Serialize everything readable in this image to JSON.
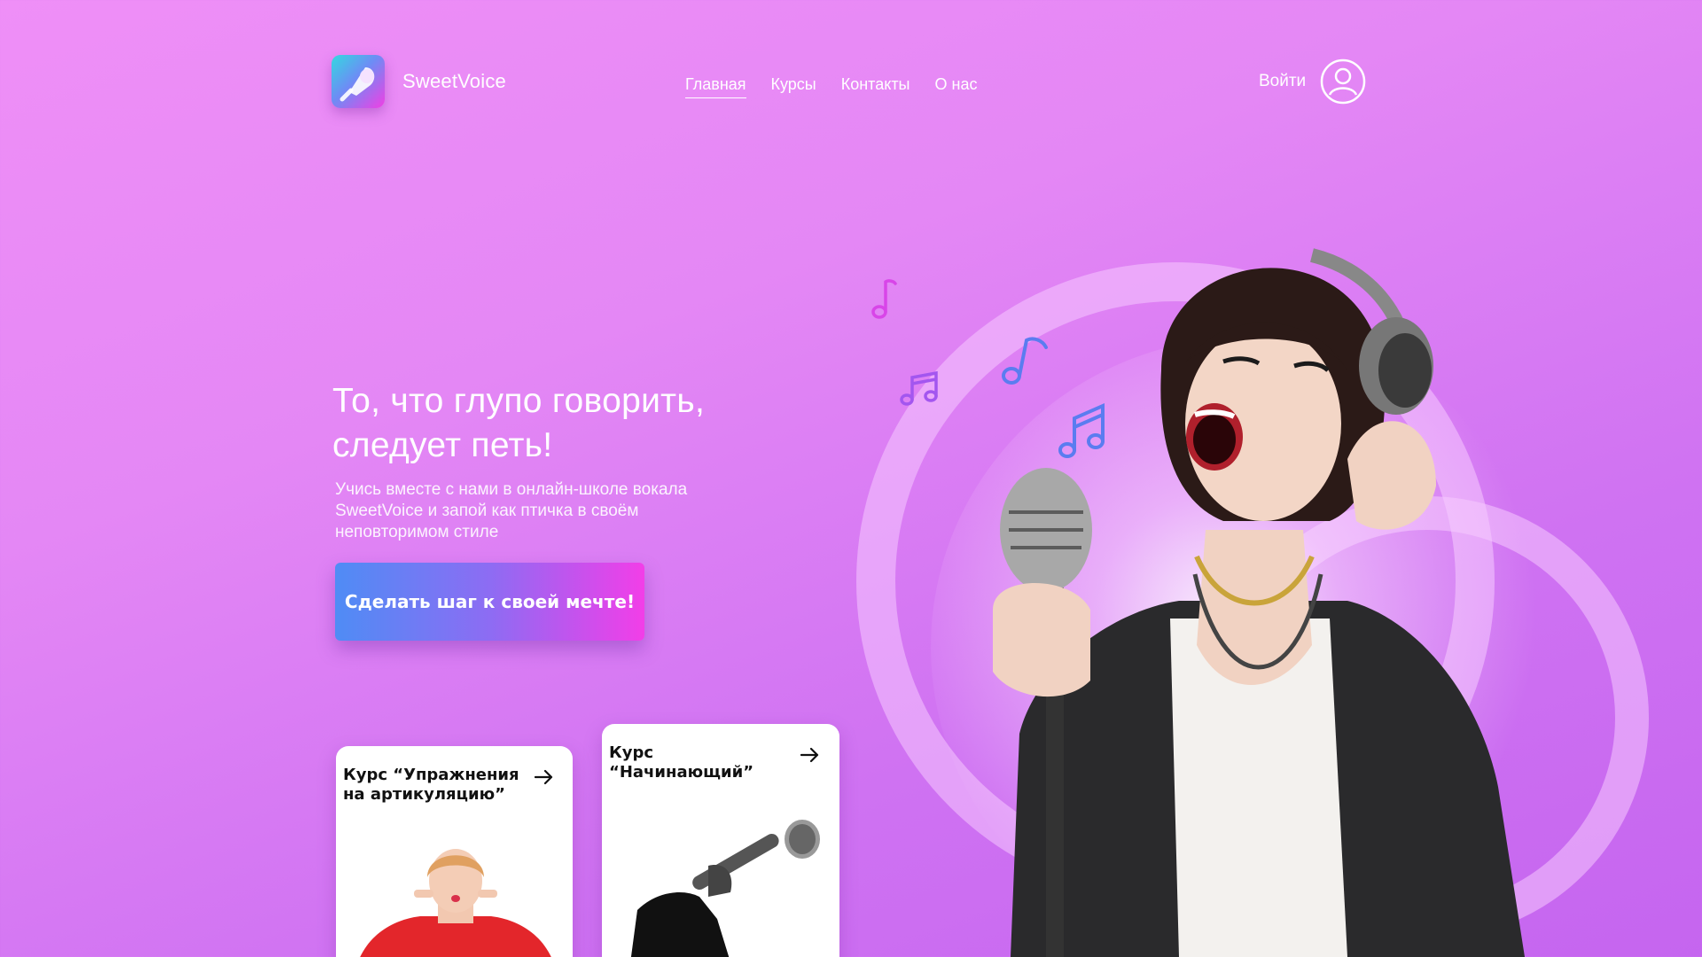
{
  "brand": {
    "name": "SweetVoice"
  },
  "nav": {
    "items": [
      {
        "label": "Главная",
        "active": true
      },
      {
        "label": "Курсы",
        "active": false
      },
      {
        "label": "Контакты",
        "active": false
      },
      {
        "label": "О нас",
        "active": false
      }
    ]
  },
  "account": {
    "login_label": "Войти",
    "icon": "user-icon"
  },
  "hero": {
    "title_line1": "То, что глупо говорить,",
    "title_line2": "следует петь!",
    "subtitle_line1": "Учись вместе с нами в онлайн-школе вокала",
    "subtitle_line2": "SweetVoice и запой как птичка в своём",
    "subtitle_line3": "неповторимом стиле",
    "cta_label": "Сделать шаг к своей мечте!"
  },
  "cards": [
    {
      "title_line1": "Курс “Упражнения",
      "title_line2": "на артикуляцию”",
      "icon": "arrow-right-icon"
    },
    {
      "title_line1": "Курс “Начинающий”",
      "title_line2": "",
      "icon": "arrow-right-icon"
    }
  ],
  "colors": {
    "background_start": "#ef8ff7",
    "background_end": "#c565ef",
    "cta_start": "#4f8cf5",
    "cta_end": "#f23ee8",
    "note_blue": "#5b7cf0",
    "note_pink": "#d845e8"
  }
}
